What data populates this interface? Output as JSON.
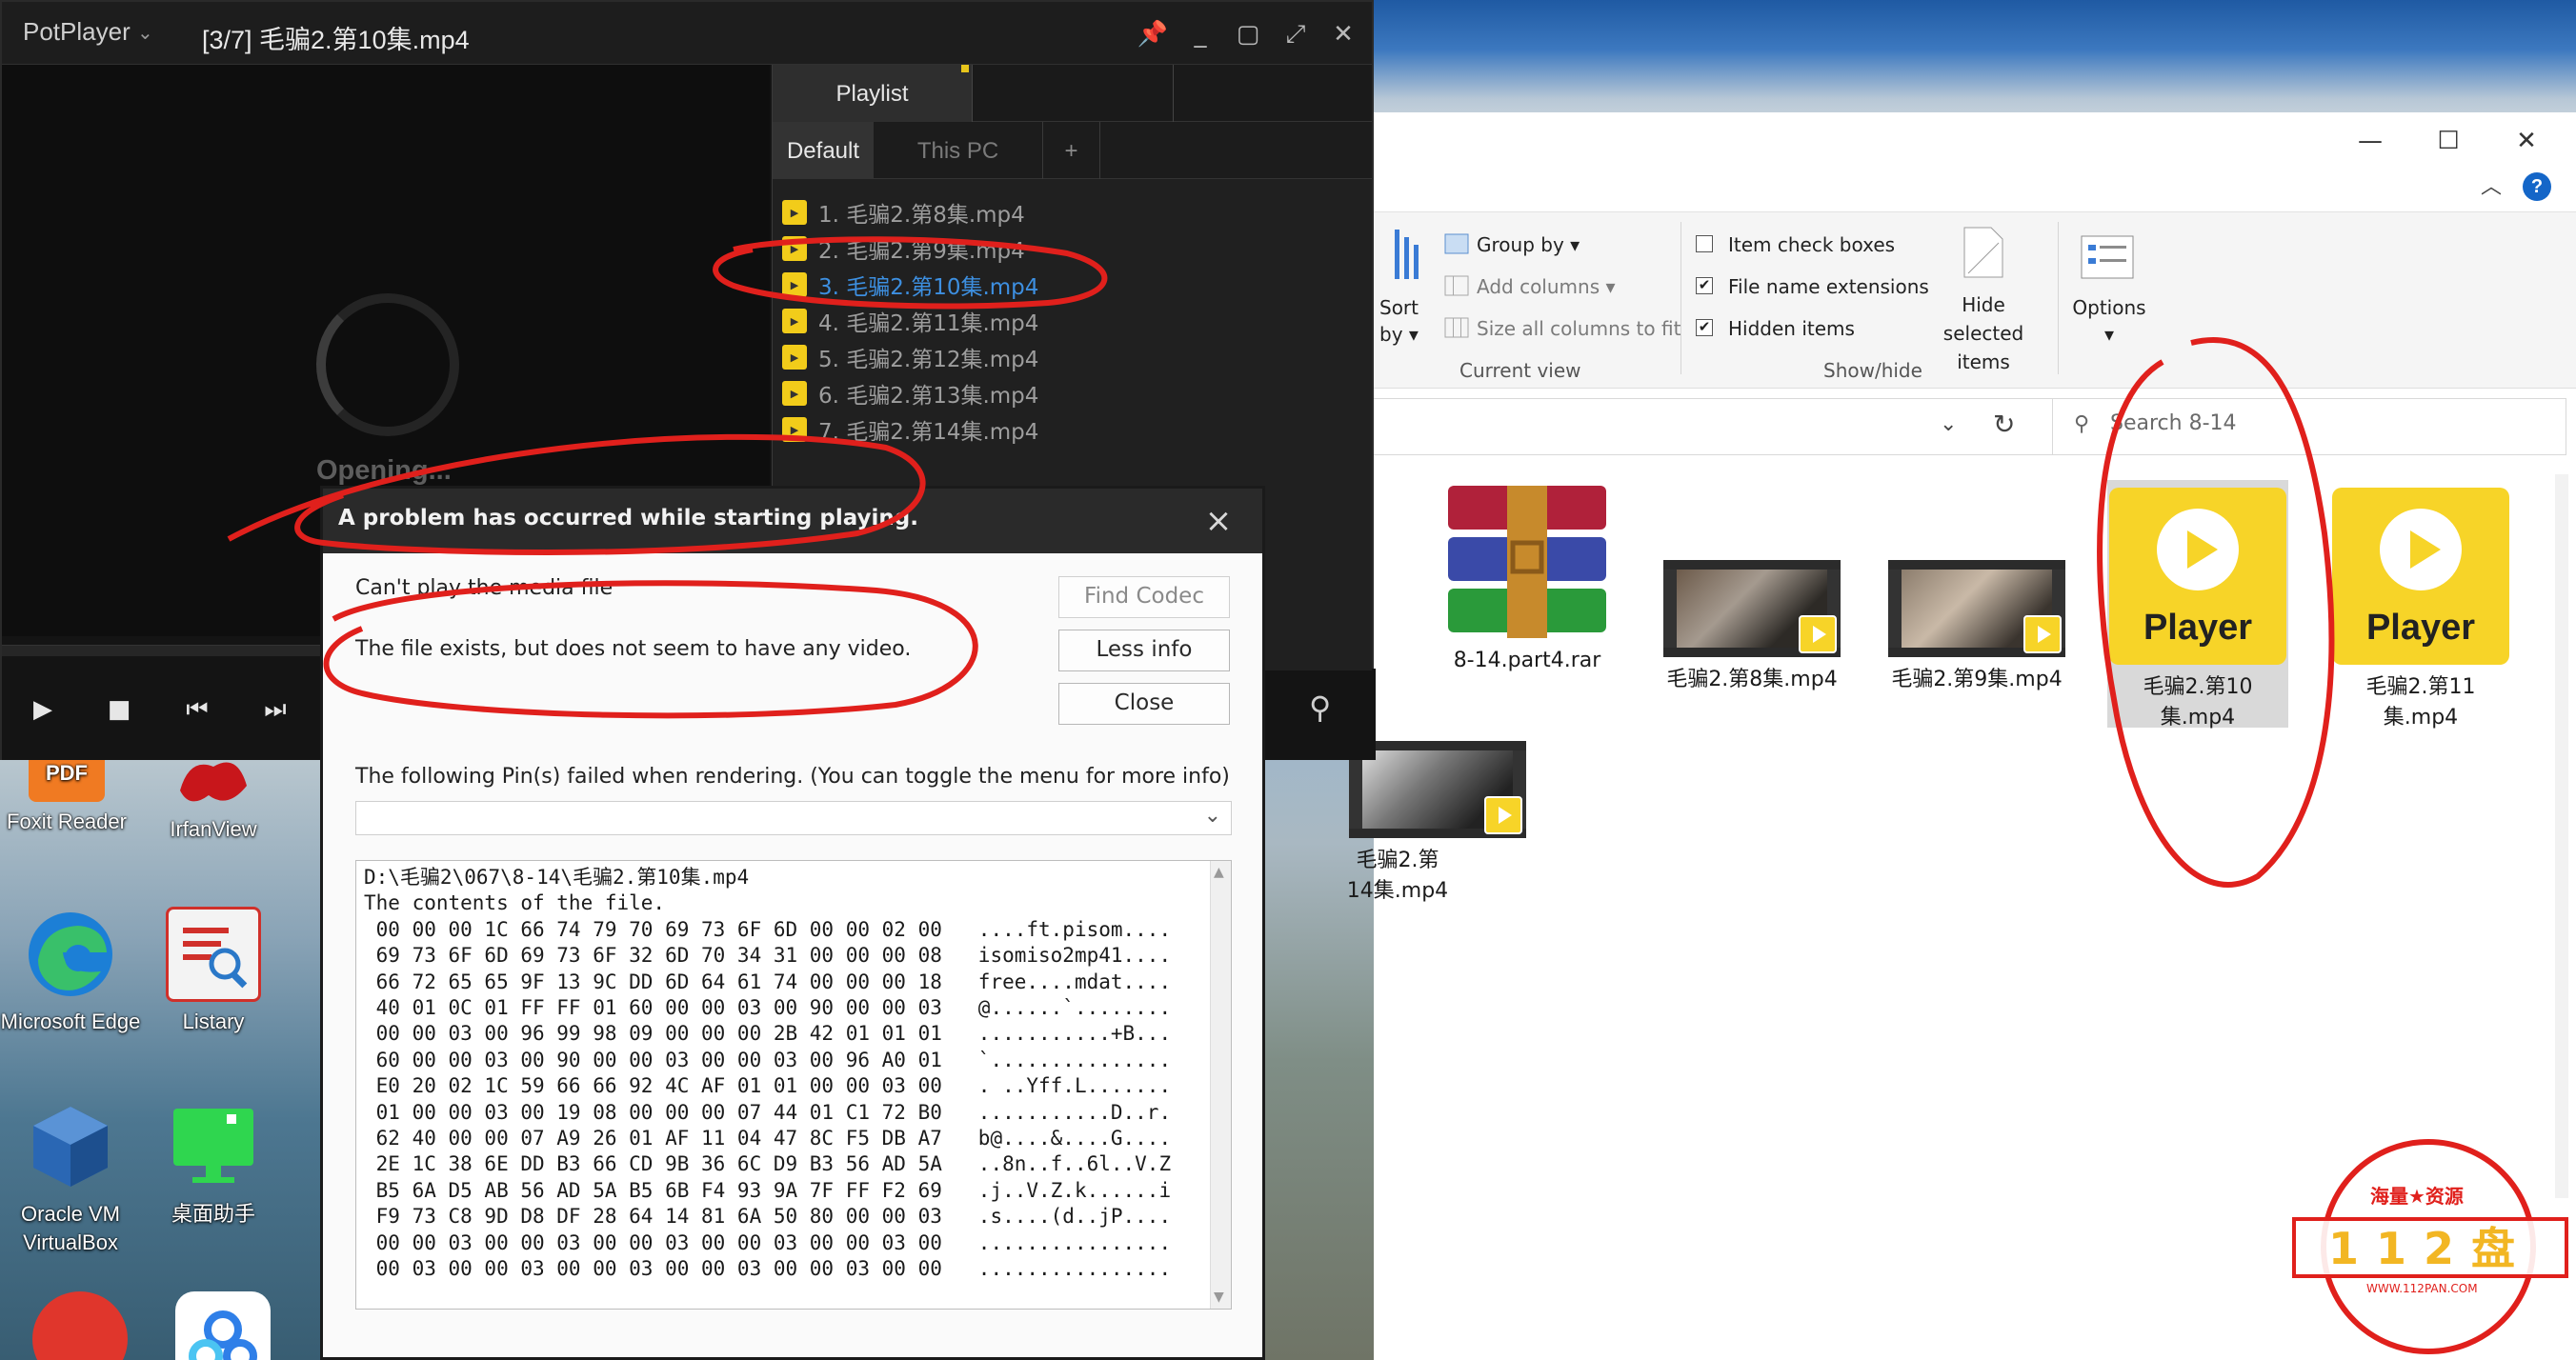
{
  "potplayer": {
    "brand": "PotPlayer",
    "title": "[3/7] 毛骗2.第10集.mp4",
    "opening_text": "Opening...",
    "playlist": {
      "header": "Playlist",
      "tabs": [
        "Default",
        "This PC",
        "+"
      ],
      "items": [
        "1. 毛骗2.第8集.mp4",
        "2. 毛骗2.第9集.mp4",
        "3. 毛骗2.第10集.mp4",
        "4. 毛骗2.第11集.mp4",
        "5. 毛骗2.第12集.mp4",
        "6. 毛骗2.第13集.mp4",
        "7. 毛骗2.第14集.mp4"
      ]
    }
  },
  "dialog": {
    "title": "A problem has occurred while starting playing.",
    "line1": "Can't play the media file",
    "line2": "The file exists, but does not seem to have any video.",
    "buttons": {
      "find_codec": "Find Codec",
      "less_info": "Less info",
      "close": "Close"
    },
    "pins_text": "The following Pin(s) failed when rendering. (You can toggle the menu for more info)",
    "hex_lines": [
      "D:\\毛骗2\\067\\8-14\\毛骗2.第10集.mp4",
      "The contents of the file.",
      " 00 00 00 1C 66 74 79 70 69 73 6F 6D 00 00 02 00   ....ft.pisom....",
      " 69 73 6F 6D 69 73 6F 32 6D 70 34 31 00 00 00 08   isomiso2mp41....",
      " 66 72 65 65 9F 13 9C DD 6D 64 61 74 00 00 00 18   free....mdat....",
      " 40 01 0C 01 FF FF 01 60 00 00 03 00 90 00 00 03   @......`........",
      " 00 00 03 00 96 99 98 09 00 00 00 2B 42 01 01 01   ...........+B...",
      " 60 00 00 03 00 90 00 00 03 00 00 03 00 96 A0 01   `...............",
      " E0 20 02 1C 59 66 66 92 4C AF 01 01 00 00 03 00   . ..Yff.L.......",
      " 01 00 00 03 00 19 08 00 00 00 07 44 01 C1 72 B0   ...........D..r.",
      " 62 40 00 00 07 A9 26 01 AF 11 04 47 8C F5 DB A7   b@....&....G....",
      " 2E 1C 38 6E DD B3 66 CD 9B 36 6C D9 B3 56 AD 5A   ..8n..f..6l..V.Z",
      " B5 6A D5 AB 56 AD 5A B5 6B F4 93 9A 7F FF F2 69   .j..V.Z.k......i",
      " F9 73 C8 9D D8 DF 28 64 14 81 6A 50 80 00 00 03   .s....(d..jP....",
      " 00 00 03 00 00 03 00 00 03 00 00 03 00 00 03 00   ................",
      " 00 03 00 00 03 00 00 03 00 00 03 00 00 03 00 00   ................"
    ]
  },
  "desktop": {
    "icons": [
      "Foxit Reader",
      "IrfanView",
      "Microsoft Edge",
      "Listary",
      "Oracle VM VirtualBox",
      "桌面助手"
    ],
    "pdf_badge": "PDF"
  },
  "explorer": {
    "ribbon": {
      "sort_by": "Sort by",
      "group_by": "Group by",
      "add_columns": "Add columns",
      "size_all_columns": "Size all columns to fit",
      "current_view": "Current view",
      "item_check_boxes": "Item check boxes",
      "file_name_extensions": "File name extensions",
      "hidden_items": "Hidden items",
      "hide_selected": "Hide selected items",
      "show_hide": "Show/hide",
      "options": "Options"
    },
    "search_placeholder": "Search 8-14",
    "files": [
      {
        "name": "8-14.part4.rar"
      },
      {
        "name": "毛骗2.第8集.mp4"
      },
      {
        "name": "毛骗2.第9集.mp4"
      },
      {
        "name": "毛骗2.第10集.mp4",
        "selected": true
      },
      {
        "name": "毛骗2.第11集.mp4"
      },
      {
        "name": "毛骗2.第14集.mp4"
      }
    ],
    "player_label": "Player"
  },
  "watermark": {
    "top": "海量★资源",
    "main": "112盘",
    "url": "WWW.112PAN.COM"
  },
  "colors": {
    "annotation_red": "#e0201c",
    "active_playlist": "#3d8fe0",
    "player_yellow": "#f7d428"
  }
}
